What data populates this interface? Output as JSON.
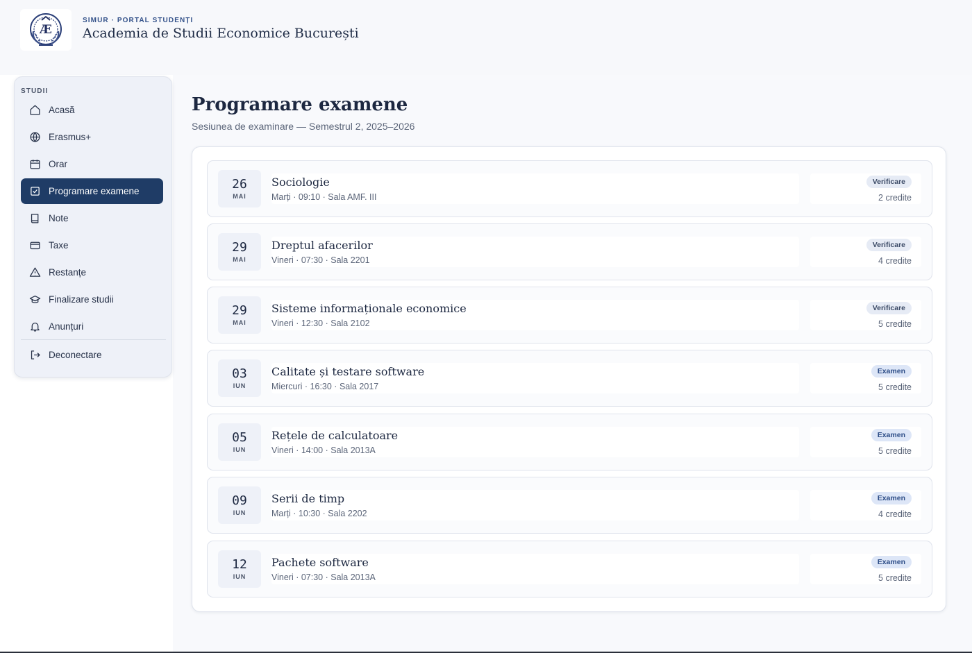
{
  "header": {
    "overline": "SIMUR · PORTAL STUDENȚI",
    "title": "Academia de Studii Economice București",
    "logo_icon": "university-crest-icon"
  },
  "sidebar": {
    "section_label": "STUDII",
    "items": [
      {
        "label": "Acasă",
        "icon": "home-icon",
        "active": false
      },
      {
        "label": "Erasmus+",
        "icon": "globe-icon",
        "active": false
      },
      {
        "label": "Orar",
        "icon": "calendar-icon",
        "active": false
      },
      {
        "label": "Programare examene",
        "icon": "calendar-check-icon",
        "active": true
      },
      {
        "label": "Note",
        "icon": "book-icon",
        "active": false
      },
      {
        "label": "Taxe",
        "icon": "credit-card-icon",
        "active": false
      },
      {
        "label": "Restanțe",
        "icon": "warning-triangle-icon",
        "active": false
      },
      {
        "label": "Finalizare studii",
        "icon": "graduation-cap-icon",
        "active": false
      },
      {
        "label": "Anunțuri",
        "icon": "bell-icon",
        "active": false
      }
    ],
    "logout": {
      "label": "Deconectare",
      "icon": "logout-icon"
    }
  },
  "main": {
    "title": "Programare examene",
    "subtitle": "Sesiunea de examinare — Semestrul 2, 2025–2026"
  },
  "exams": [
    {
      "day": "26",
      "month": "MAI",
      "name": "Sociologie",
      "meta": "Marți · 09:10 · Sala AMF. III",
      "type": "Verificare",
      "credits": "2 credite"
    },
    {
      "day": "29",
      "month": "MAI",
      "name": "Dreptul afacerilor",
      "meta": "Vineri · 07:30 · Sala 2201",
      "type": "Verificare",
      "credits": "4 credite"
    },
    {
      "day": "29",
      "month": "MAI",
      "name": "Sisteme informaționale economice",
      "meta": "Vineri · 12:30 · Sala 2102",
      "type": "Verificare",
      "credits": "5 credite"
    },
    {
      "day": "03",
      "month": "IUN",
      "name": "Calitate și testare software",
      "meta": "Miercuri · 16:30 · Sala 2017",
      "type": "Examen",
      "credits": "5 credite"
    },
    {
      "day": "05",
      "month": "IUN",
      "name": "Rețele de calculatoare",
      "meta": "Vineri · 14:00 · Sala 2013A",
      "type": "Examen",
      "credits": "5 credite"
    },
    {
      "day": "09",
      "month": "IUN",
      "name": "Serii de timp",
      "meta": "Marți · 10:30 · Sala 2202",
      "type": "Examen",
      "credits": "4 credite"
    },
    {
      "day": "12",
      "month": "IUN",
      "name": "Pachete software",
      "meta": "Vineri · 07:30 · Sala 2013A",
      "type": "Examen",
      "credits": "5 credite"
    }
  ],
  "colors": {
    "accent": "#1f3c66",
    "badge_verificare": "#e6ebf5",
    "badge_examen": "#dde6f7"
  }
}
